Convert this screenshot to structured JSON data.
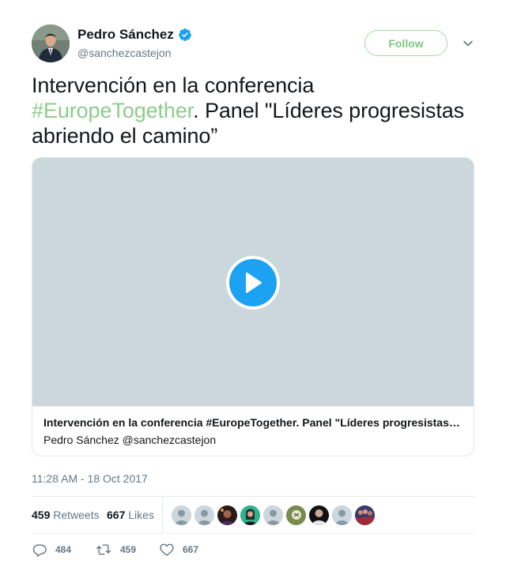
{
  "author": {
    "name": "Pedro Sánchez",
    "handle": "@sanchezcastejon",
    "verified": true,
    "avatar_icon": "profile-photo"
  },
  "follow_label": "Follow",
  "menu_icon": "chevron-down-icon",
  "tweet": {
    "text_before": "Intervención en la conferencia ",
    "hashtag": "#EuropeTogether",
    "text_after": ". Panel \"Líderes progresistas abriendo el camino”"
  },
  "card": {
    "title": "Intervención en la conferencia #EuropeTogether. Panel \"Líderes progresistas abriendo el camino”",
    "byline": "Pedro Sánchez @sanchezcastejon",
    "play_icon": "play-icon"
  },
  "timestamp": "11:28 AM - 18 Oct 2017",
  "stats": {
    "retweets_count": "459",
    "retweets_label": "Retweets",
    "likes_count": "667",
    "likes_label": "Likes"
  },
  "likers": [
    {
      "name": "liker-1",
      "style": "default"
    },
    {
      "name": "liker-2",
      "style": "default"
    },
    {
      "name": "liker-3",
      "style": "photo-dark"
    },
    {
      "name": "liker-4",
      "style": "photo-teal"
    },
    {
      "name": "liker-5",
      "style": "default"
    },
    {
      "name": "liker-6",
      "style": "photo-olive"
    },
    {
      "name": "liker-7",
      "style": "photo-black"
    },
    {
      "name": "liker-8",
      "style": "default"
    },
    {
      "name": "liker-9",
      "style": "photo-crowd"
    }
  ],
  "actions": {
    "reply_count": "484",
    "retweet_count": "459",
    "like_count": "667"
  },
  "colors": {
    "accent_green": "#8ccc8c",
    "play_blue": "#1da1f2",
    "verified_blue": "#1da1f2",
    "muted_text": "#657786"
  }
}
